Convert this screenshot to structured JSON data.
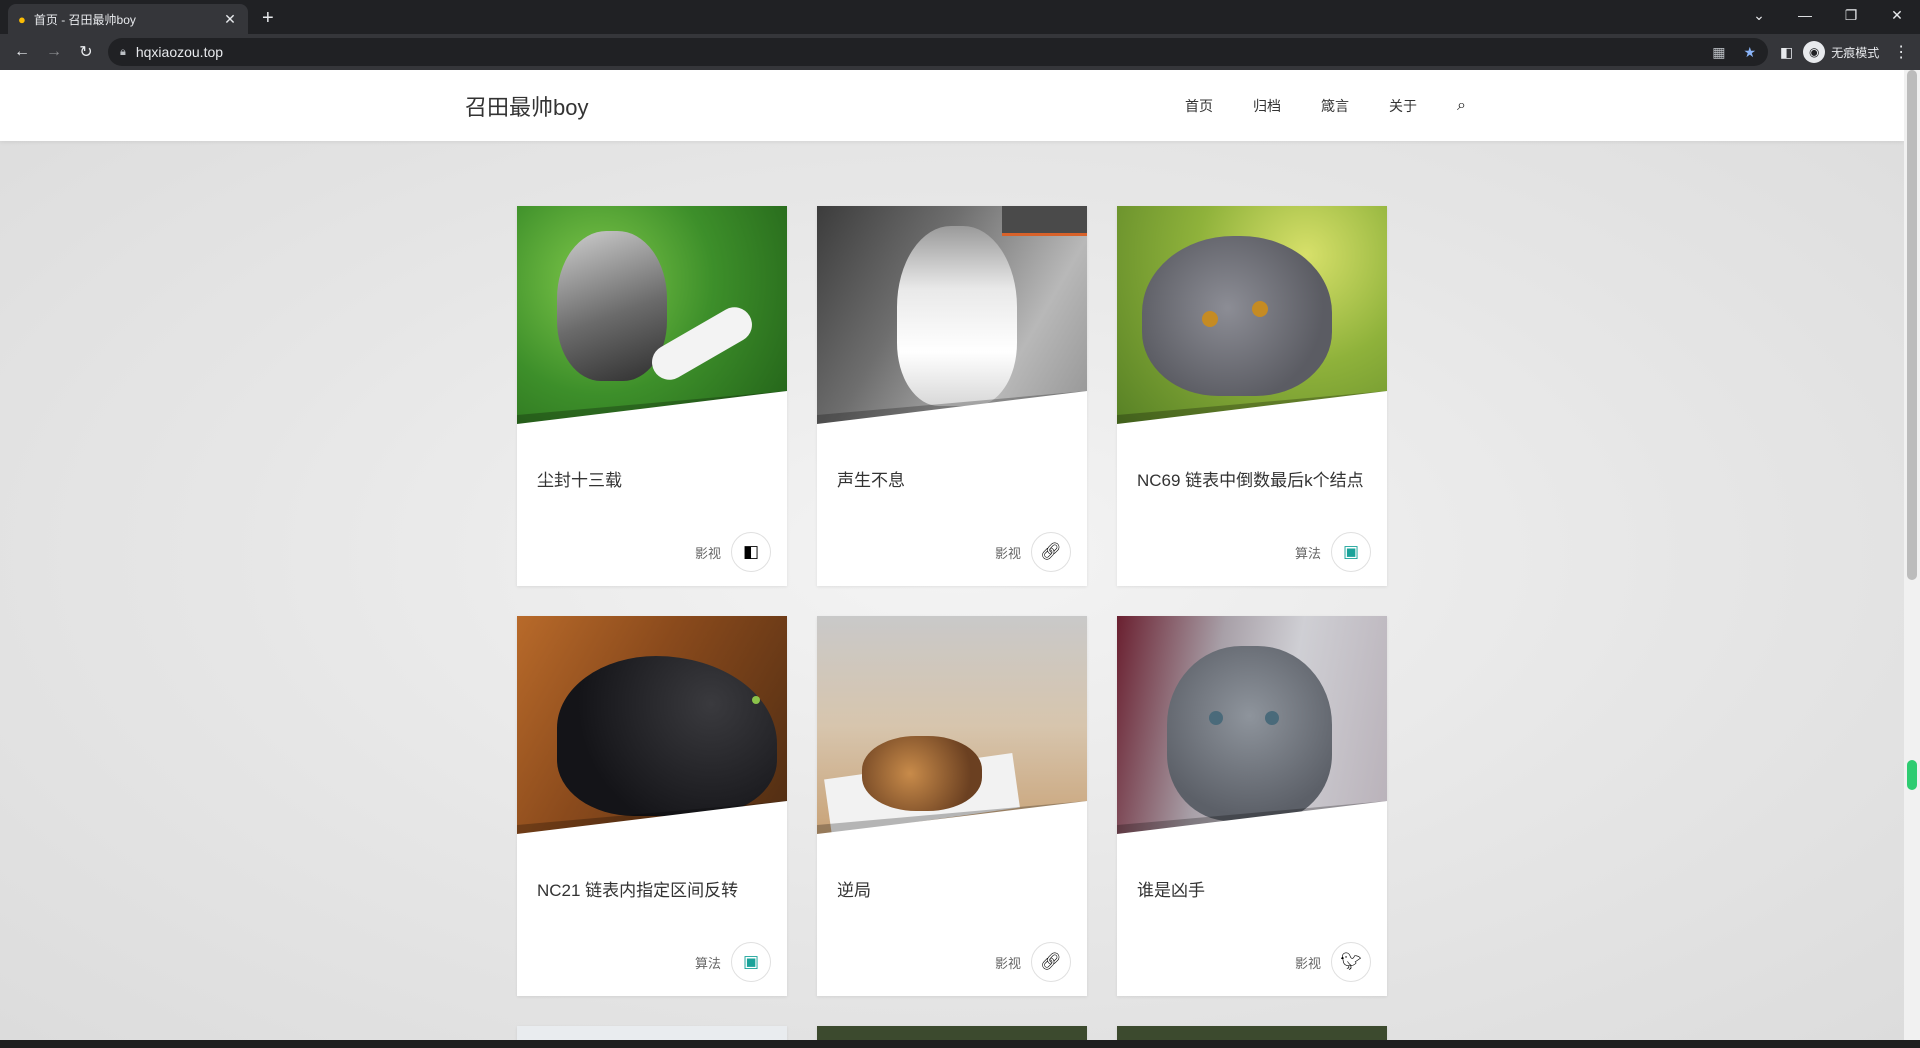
{
  "browser": {
    "tab_title": "首页 - 召田最帅boy",
    "url": "hqxiaozou.top",
    "incognito_label": "无痕模式"
  },
  "site": {
    "logo": "召田最帅boy",
    "nav": [
      "首页",
      "归档",
      "箴言",
      "关于"
    ]
  },
  "cards": [
    {
      "title": "尘封十三载",
      "category": "影视",
      "icon": "film-icon"
    },
    {
      "title": "声生不息",
      "category": "影视",
      "icon": "link-icon"
    },
    {
      "title": "NC69 链表中倒数最后k个结点",
      "category": "算法",
      "icon": "monitor-icon"
    },
    {
      "title": "NC21 链表内指定区间反转",
      "category": "算法",
      "icon": "monitor-icon"
    },
    {
      "title": "逆局",
      "category": "影视",
      "icon": "link-icon"
    },
    {
      "title": "谁是凶手",
      "category": "影视",
      "icon": "bird-icon"
    }
  ],
  "colors": {
    "accent": "#2ecc71",
    "header_bg": "#ffffff",
    "page_bg": "#e4e4e4"
  }
}
